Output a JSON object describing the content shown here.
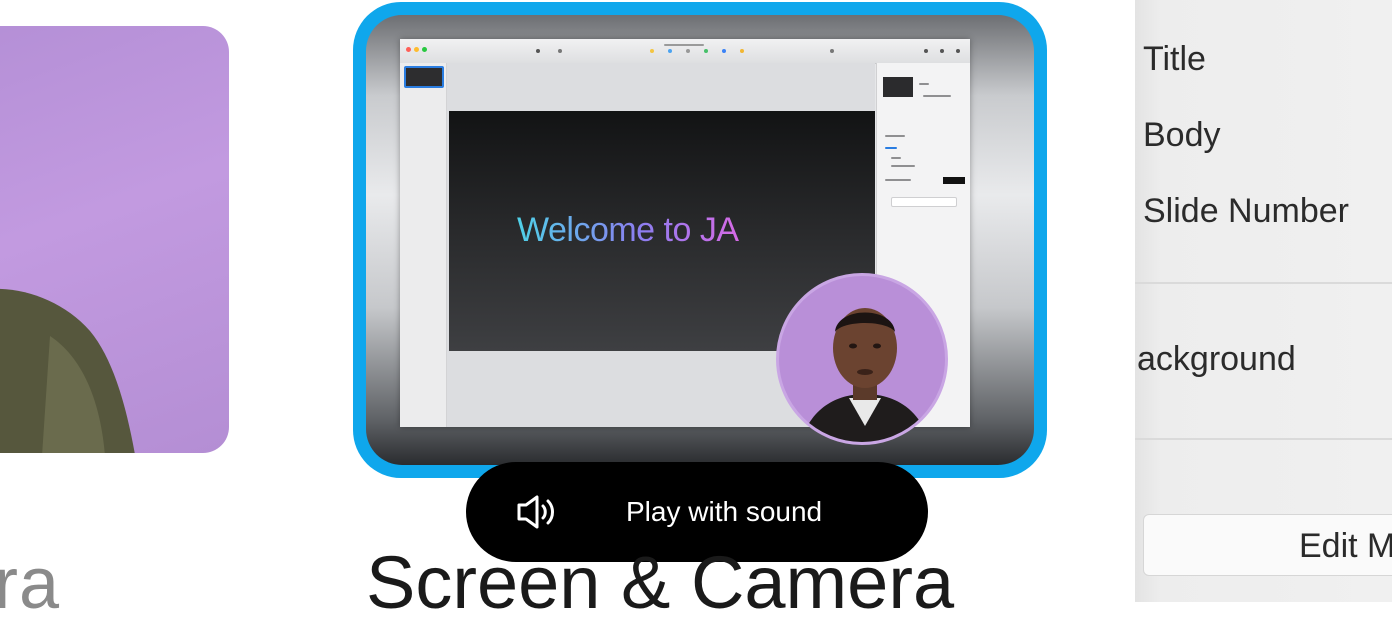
{
  "left_card": {
    "caption": "ra"
  },
  "center_card": {
    "slide_title": "Welcome to JA",
    "accent_color": "#0fa7ec",
    "caption": "Screen & Camera"
  },
  "sound_button": {
    "icon": "speaker-sound-icon",
    "label": "Play with sound"
  },
  "right_panel": {
    "items": [
      "Title",
      "Body",
      "Slide Number"
    ],
    "background_label": "ackground",
    "edit_button_label": "Edit M"
  }
}
